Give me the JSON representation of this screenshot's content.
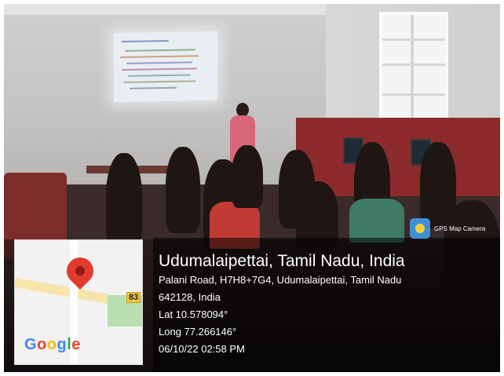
{
  "gps_badge": {
    "label": "GPS Map Camera",
    "icon": "camera-map-icon"
  },
  "location": {
    "title": "Udumalaipettai, Tamil Nadu, India",
    "address_line1": "Palani Road, H7H8+7G4, Udumalaipettai, Tamil Nadu",
    "address_line2": "642128, India",
    "lat": "Lat 10.578094°",
    "long": "Long 77.266146°",
    "datetime": "06/10/22 02:58 PM"
  },
  "map": {
    "road_number": "83",
    "logo": "Google",
    "pin_icon": "map-pin-icon",
    "colors": {
      "pin": "#e23a2d",
      "road": "#f6e4a8",
      "park": "#b9dfb0"
    }
  }
}
